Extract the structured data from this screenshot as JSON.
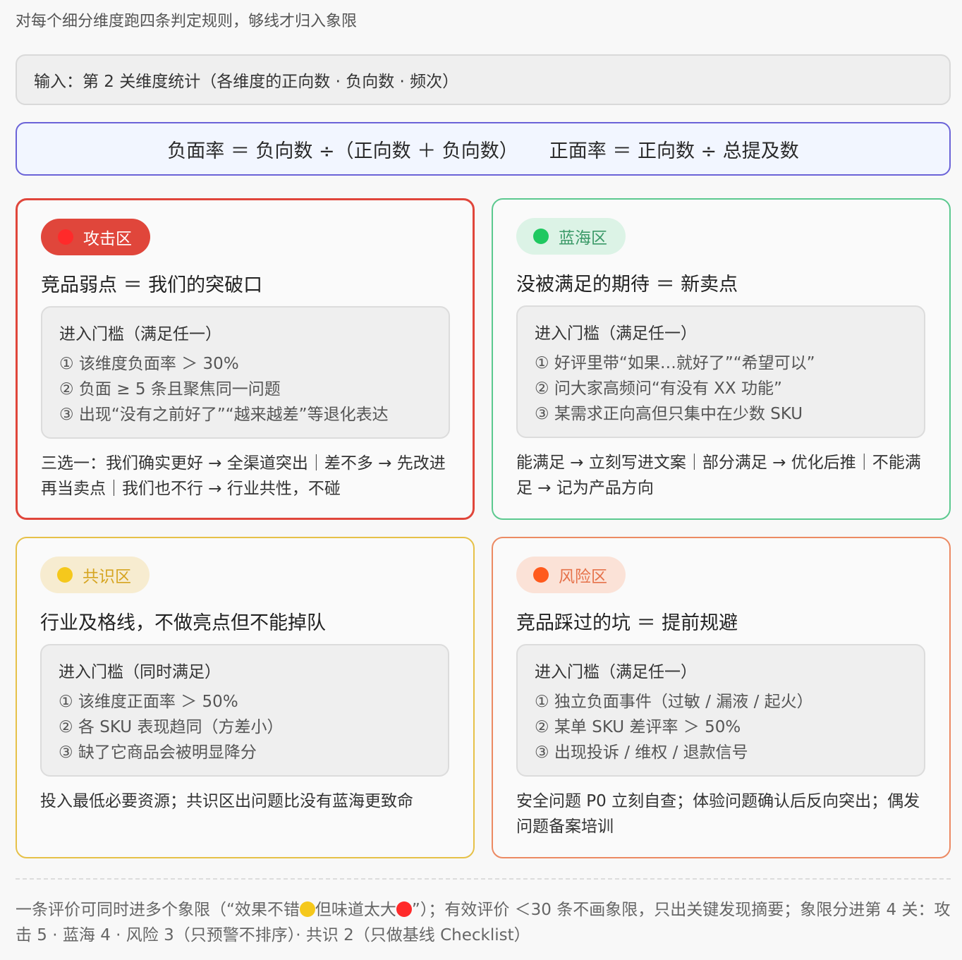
{
  "intro": "对每个细分维度跑四条判定规则，够线才归入象限",
  "input": "输入：第 2 关维度统计（各维度的正向数 · 负向数 · 频次）",
  "formulas": {
    "negative_rate": "负面率 ＝ 负向数 ÷（正向数 ＋ 负向数）",
    "positive_rate": "正面率 ＝ 正向数 ÷ 总提及数"
  },
  "quadrants": {
    "attack": {
      "badge": "攻击区",
      "color": "#e0463b",
      "title": "竞品弱点 ＝ 我们的突破口",
      "threshold_title": "进入门槛（满足任一）",
      "items": [
        "① 该维度负面率 ＞ 30%",
        "② 负面 ≥ 5 条且聚焦同一问题",
        "③ 出现“没有之前好了”“越来越差”等退化表达"
      ],
      "action": "三选一：我们确实更好 → 全渠道突出｜差不多 → 先改进再当卖点｜我们也不行 → 行业共性，不碰"
    },
    "blue_ocean": {
      "badge": "蓝海区",
      "color": "#1fc860",
      "title": "没被满足的期待 ＝ 新卖点",
      "threshold_title": "进入门槛（满足任一）",
      "items": [
        "① 好评里带“如果…就好了”“希望可以”",
        "② 问大家高频问“有没有 XX 功能”",
        "③ 某需求正向高但只集中在少数 SKU"
      ],
      "action": "能满足 → 立刻写进文案｜部分满足 → 优化后推｜不能满足 → 记为产品方向"
    },
    "consensus": {
      "badge": "共识区",
      "color": "#f5c81c",
      "title": "行业及格线，不做亮点但不能掉队",
      "threshold_title": "进入门槛（同时满足）",
      "items": [
        "① 该维度正面率 ＞ 50%",
        "② 各 SKU 表现趋同（方差小）",
        "③ 缺了它商品会被明显降分"
      ],
      "action": "投入最低必要资源；共识区出问题比没有蓝海更致命"
    },
    "risk": {
      "badge": "风险区",
      "color": "#ff5a1c",
      "title": "竞品踩过的坑 ＝ 提前规避",
      "threshold_title": "进入门槛（满足任一）",
      "items": [
        "① 独立负面事件（过敏 / 漏液 / 起火）",
        "② 某单 SKU 差评率 ＞ 50%",
        "③ 出现投诉 / 维权 / 退款信号"
      ],
      "action": "安全问题 P0 立刻自查；体验问题确认后反向突出；偶发问题备案培训"
    }
  },
  "footnote": {
    "part1": "一条评价可同时进多个象限（“效果不错",
    "part2": "但味道太大",
    "part3": "”）；有效评价 ＜30 条不画象限，只出关键发现摘要；象限分进第 4 关：攻击 5 · 蓝海 4 · 风险 3（只预警不排序）· 共识 2（只做基线 Checklist）"
  }
}
